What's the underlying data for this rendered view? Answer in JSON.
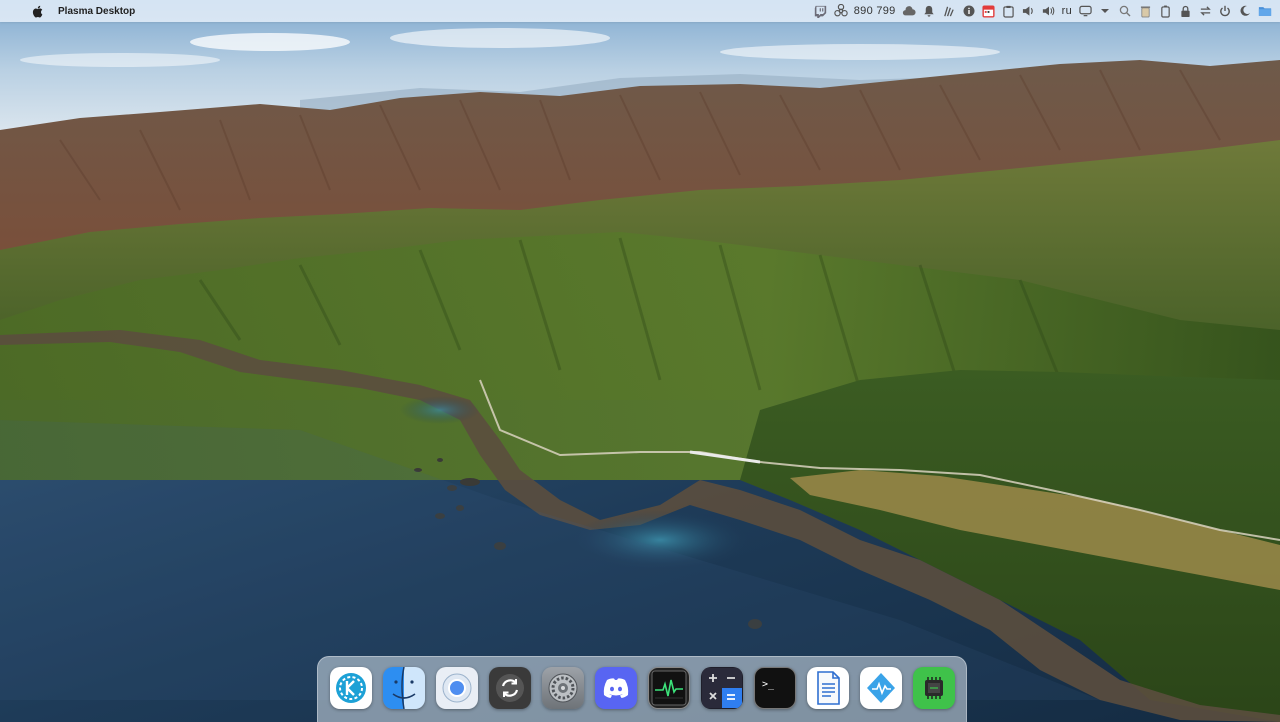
{
  "topbar": {
    "apple_icon": "apple-logo-icon",
    "app_name": "Plasma Desktop",
    "counter": "890 799",
    "language": "ru",
    "tray_icons": [
      "twitch-icon",
      "biohazard-icon",
      "cloud-icon",
      "notifications-icon",
      "weather-icon",
      "info-icon",
      "calendar-app-icon",
      "clipboard-icon",
      "speaker-icon",
      "volume-icon",
      "language-indicator",
      "display-icon",
      "dropdown-arrow-icon",
      "search-icon",
      "trash-icon",
      "battery-icon",
      "lock-icon",
      "switch-user-icon",
      "power-icon",
      "night-mode-icon",
      "folder-icon"
    ]
  },
  "dock": {
    "items": [
      {
        "name": "kde-launcher",
        "icon": "kde-icon"
      },
      {
        "name": "finder",
        "icon": "finder-icon"
      },
      {
        "name": "chromium-browser",
        "icon": "chromium-icon"
      },
      {
        "name": "software-update",
        "icon": "sync-icon"
      },
      {
        "name": "system-settings",
        "icon": "settings-gear-icon"
      },
      {
        "name": "discord",
        "icon": "discord-icon"
      },
      {
        "name": "activity-monitor",
        "icon": "activity-monitor-icon"
      },
      {
        "name": "calculator",
        "icon": "calculator-icon"
      },
      {
        "name": "terminal",
        "icon": "terminal-icon"
      },
      {
        "name": "text-editor",
        "icon": "document-icon"
      },
      {
        "name": "system-monitor",
        "icon": "monitor-graph-icon"
      },
      {
        "name": "gpu-monitor",
        "icon": "chip-icon"
      }
    ]
  },
  "colors": {
    "topbar_bg": "#e8f0fa",
    "dock_bg": "#d7e1eb",
    "sea": "#1f3d5c",
    "mountains": "#5a6b2e"
  }
}
